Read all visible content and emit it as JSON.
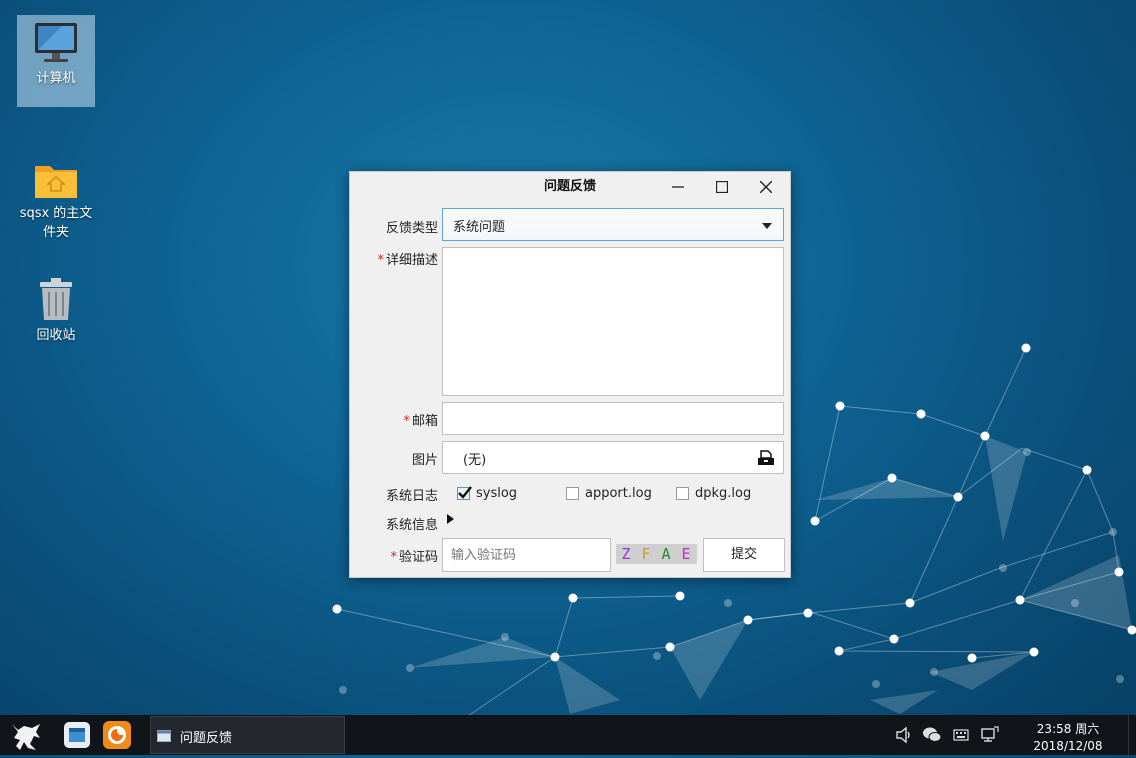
{
  "desktop": {
    "icons": [
      {
        "label": "计算机",
        "icon": "computer-icon"
      },
      {
        "label": "sqsx 的主文件夹",
        "icon": "home-folder-icon"
      },
      {
        "label": "回收站",
        "icon": "trash-icon"
      }
    ]
  },
  "dialog": {
    "title": "问题反馈",
    "type_label": "反馈类型",
    "type_value": "系统问题",
    "desc_label": "详细描述",
    "email_label": "邮箱",
    "image_label": "图片",
    "image_value": "(无)",
    "syslog_label": "系统日志",
    "logs": [
      {
        "label": "syslog",
        "checked": true
      },
      {
        "label": "apport.log",
        "checked": false
      },
      {
        "label": "dpkg.log",
        "checked": false
      }
    ],
    "sysinfo_label": "系统信息",
    "captcha_label": "验证码",
    "captcha_placeholder": "输入验证码",
    "captcha_chars": [
      "Z",
      "F",
      "A",
      "E"
    ],
    "captcha_colors": [
      "#9a2fd0",
      "#c0a030",
      "#2a8a2a",
      "#c030c0"
    ],
    "submit_label": "提交",
    "required_mark": "*"
  },
  "taskbar": {
    "task_label": "问题反馈",
    "clock_time": "23:58 周六",
    "clock_date": "2018/12/08"
  },
  "colors": {
    "accent": "#5aa9d6",
    "required": "#e02020"
  }
}
